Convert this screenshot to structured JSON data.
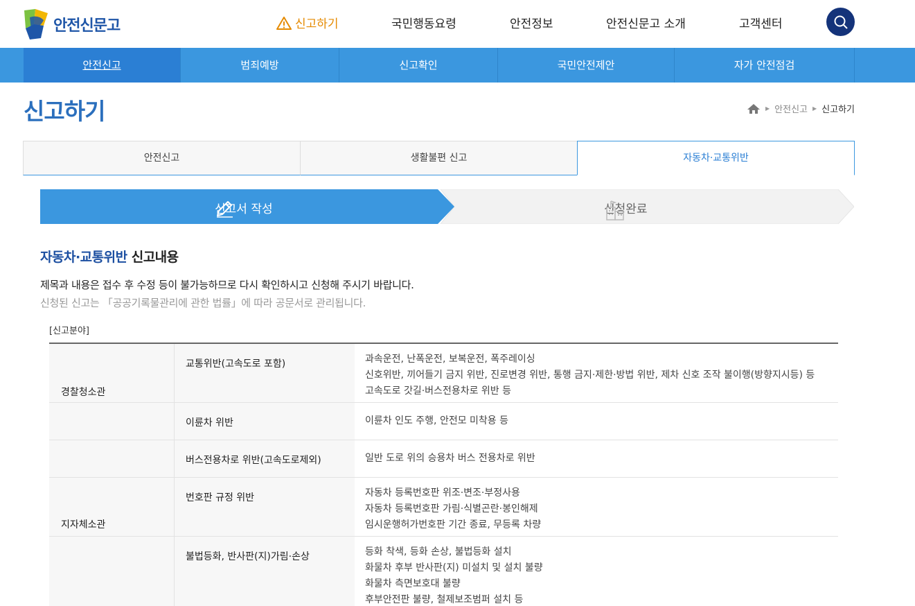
{
  "header": {
    "logo_text": "안전신문고",
    "gnb": [
      "신고하기",
      "국민행동요령",
      "안전정보",
      "안전신문고 소개",
      "고객센터"
    ]
  },
  "subnav": [
    "안전신고",
    "범죄예방",
    "신고확인",
    "국민안전제안",
    "자가 안전점검"
  ],
  "page_title": "신고하기",
  "breadcrumb": {
    "level1": "안전신고",
    "current": "신고하기"
  },
  "tabs": [
    "안전신고",
    "생활불편 신고",
    "자동차·교통위반"
  ],
  "steps": {
    "step1": "신고서 작성",
    "step2": "신청완료"
  },
  "section": {
    "title_highlight": "자동차·교통위반",
    "title_rest": " 신고내용",
    "notice1": "제목과 내용은 접수 후 수정 등이 불가능하므로 다시 확인하시고 신청해 주시기 바랍니다.",
    "notice2": "신청된 신고는 「공공기록물관리에 관한 법률」에 따라 공문서로 관리됩니다.",
    "field_label": "[신고분야]"
  },
  "table": {
    "groups": [
      "경찰청소관",
      "지자체소관"
    ],
    "rows": [
      {
        "category": "교통위반(고속도로 포함)",
        "desc": [
          "과속운전, 난폭운전, 보복운전, 폭주레이싱",
          "신호위반, 끼어들기 금지 위반, 진로변경 위반, 통행 금지·제한·방법 위반, 제차 신호 조작 불이행(방향지시등) 등",
          "고속도로 갓길·버스전용차로 위반 등"
        ]
      },
      {
        "category": "이륜차 위반",
        "desc": [
          "이륜차 인도 주행, 안전모 미착용 등"
        ]
      },
      {
        "category": "버스전용차로 위반(고속도로제외)",
        "desc": [
          "일반 도로 위의 승용차 버스 전용차로 위반"
        ]
      },
      {
        "category": "번호판 규정 위반",
        "desc": [
          "자동차 등록번호판 위조·변조·부정사용",
          "자동차 등록번호판 가림·식별곤란·봉인해제",
          "임시운행허가번호판 기간 종료, 무등록 차량"
        ]
      },
      {
        "category": "불법등화, 반사판(지)가림·손상",
        "desc": [
          "등화 착색, 등화 손상, 불법등화 설치",
          "화물차 후부 반사판(지) 미설치 및 설치 불량",
          "화물차 측면보호대 불량",
          "후부안전판 불량, 철제보조범퍼 설치 등"
        ]
      }
    ]
  }
}
